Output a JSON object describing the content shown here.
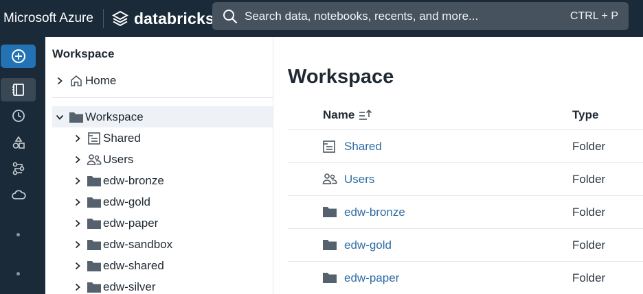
{
  "topbar": {
    "brand": "Microsoft Azure",
    "product": "databricks",
    "search_placeholder": "Search data, notebooks, recents, and more...",
    "search_shortcut": "CTRL + P"
  },
  "rail": {
    "items": [
      "new-icon",
      "workspace-icon",
      "recents-icon",
      "catalog-icon",
      "workflows-icon",
      "compute-icon"
    ]
  },
  "tree": {
    "title": "Workspace",
    "home_label": "Home",
    "root_label": "Workspace",
    "children": [
      {
        "label": "Shared",
        "icon": "shared-folder-icon"
      },
      {
        "label": "Users",
        "icon": "users-icon"
      },
      {
        "label": "edw-bronze",
        "icon": "folder-icon"
      },
      {
        "label": "edw-gold",
        "icon": "folder-icon"
      },
      {
        "label": "edw-paper",
        "icon": "folder-icon"
      },
      {
        "label": "edw-sandbox",
        "icon": "folder-icon"
      },
      {
        "label": "edw-shared",
        "icon": "folder-icon"
      },
      {
        "label": "edw-silver",
        "icon": "folder-icon"
      }
    ]
  },
  "main": {
    "title": "Workspace",
    "columns": {
      "name": "Name",
      "type": "Type"
    },
    "rows": [
      {
        "name": "Shared",
        "type": "Folder",
        "icon": "shared-folder-icon"
      },
      {
        "name": "Users",
        "type": "Folder",
        "icon": "users-icon"
      },
      {
        "name": "edw-bronze",
        "type": "Folder",
        "icon": "folder-icon"
      },
      {
        "name": "edw-gold",
        "type": "Folder",
        "icon": "folder-icon"
      },
      {
        "name": "edw-paper",
        "type": "Folder",
        "icon": "folder-icon"
      }
    ]
  },
  "colors": {
    "topbar_bg": "#1b2a38",
    "accent": "#2272b4",
    "link": "#2e6da4",
    "folder": "#55616d"
  }
}
